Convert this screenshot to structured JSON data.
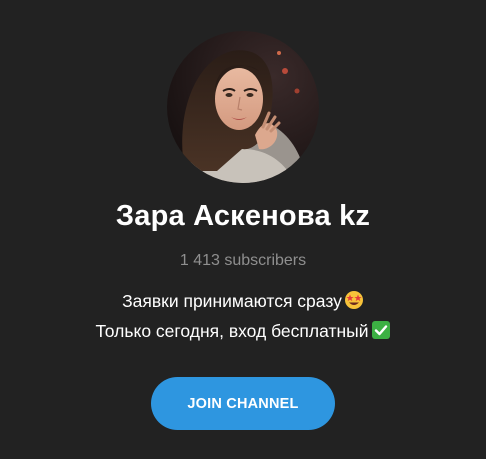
{
  "channel": {
    "title": "Зара Аскенова kz",
    "subscribers": "1 413 subscribers",
    "description_line1": "Заявки принимаются сразу",
    "description_line2": "Только сегодня, вход бесплатный",
    "line1_emoji_icon": "star-struck-emoji-icon",
    "line2_emoji_icon": "check-mark-button-emoji-icon"
  },
  "join_button": {
    "label": "JOIN CHANNEL"
  },
  "colors": {
    "background": "#222222",
    "title_text": "#ffffff",
    "subscribers_text": "#8f8f8f",
    "button_bg": "#2e96e0",
    "button_text": "#ffffff"
  }
}
